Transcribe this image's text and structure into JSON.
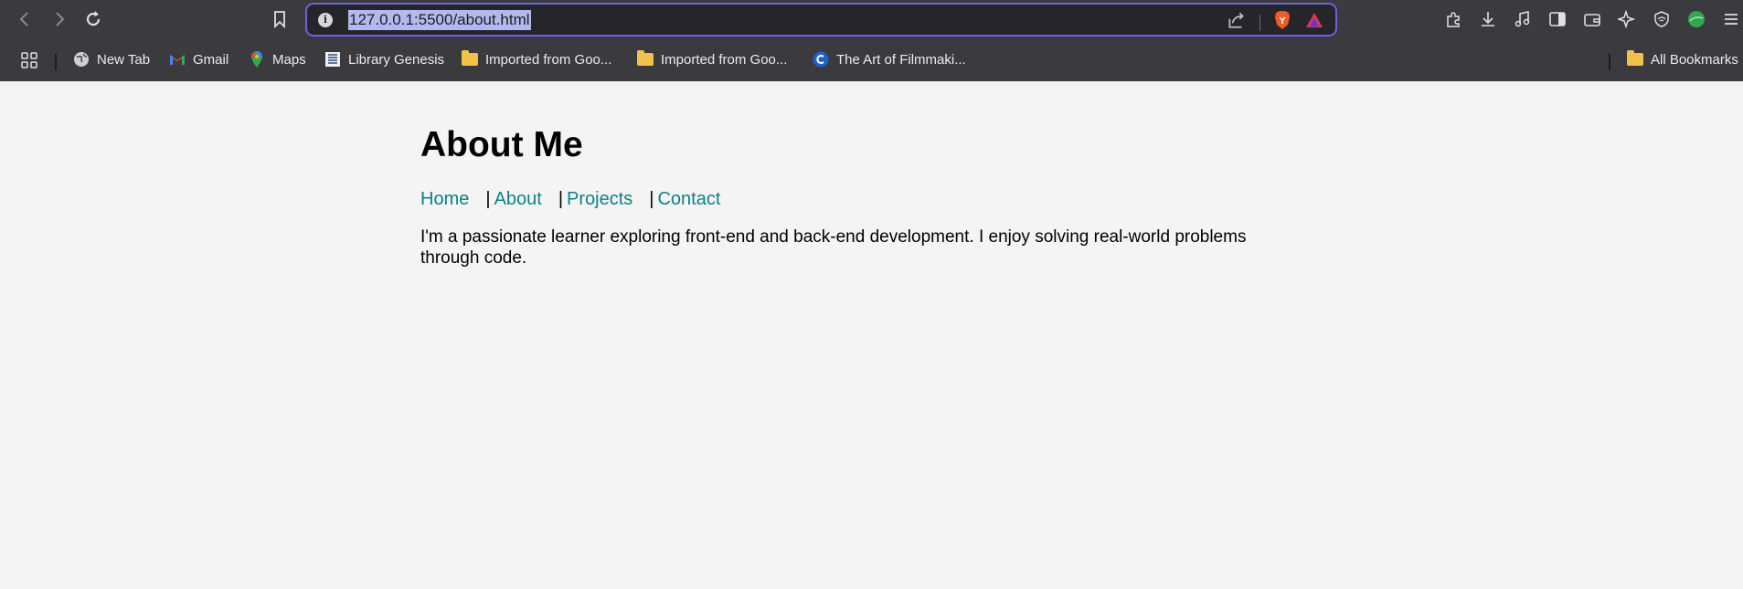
{
  "browser": {
    "url": "127.0.0.1:5500/about.html",
    "accent_color": "#6a62e0",
    "nav_icons": [
      "back-icon",
      "forward-icon",
      "reload-icon",
      "bookmark-icon"
    ],
    "bookmarks": [
      {
        "label": "New Tab",
        "icon": "globe-icon"
      },
      {
        "label": "Gmail",
        "icon": "gmail-icon"
      },
      {
        "label": "Maps",
        "icon": "maps-icon"
      },
      {
        "label": "Library Genesis",
        "icon": "libgen-icon"
      },
      {
        "label": "Imported from Goo...",
        "icon": "folder-icon"
      },
      {
        "label": "Imported from Goo...",
        "icon": "folder-icon"
      },
      {
        "label": "The Art of Filmmaki...",
        "icon": "c-icon"
      }
    ],
    "all_bookmarks_label": "All Bookmarks"
  },
  "page": {
    "title": "About Me",
    "nav": {
      "home": "Home",
      "about": "About",
      "projects": "Projects",
      "contact": "Contact",
      "separator": "|"
    },
    "paragraph": "I'm a passionate learner exploring front-end and back-end development. I enjoy solving real-world problems through code.",
    "link_color": "#0f7f84",
    "background_color": "#f4f4f4"
  }
}
